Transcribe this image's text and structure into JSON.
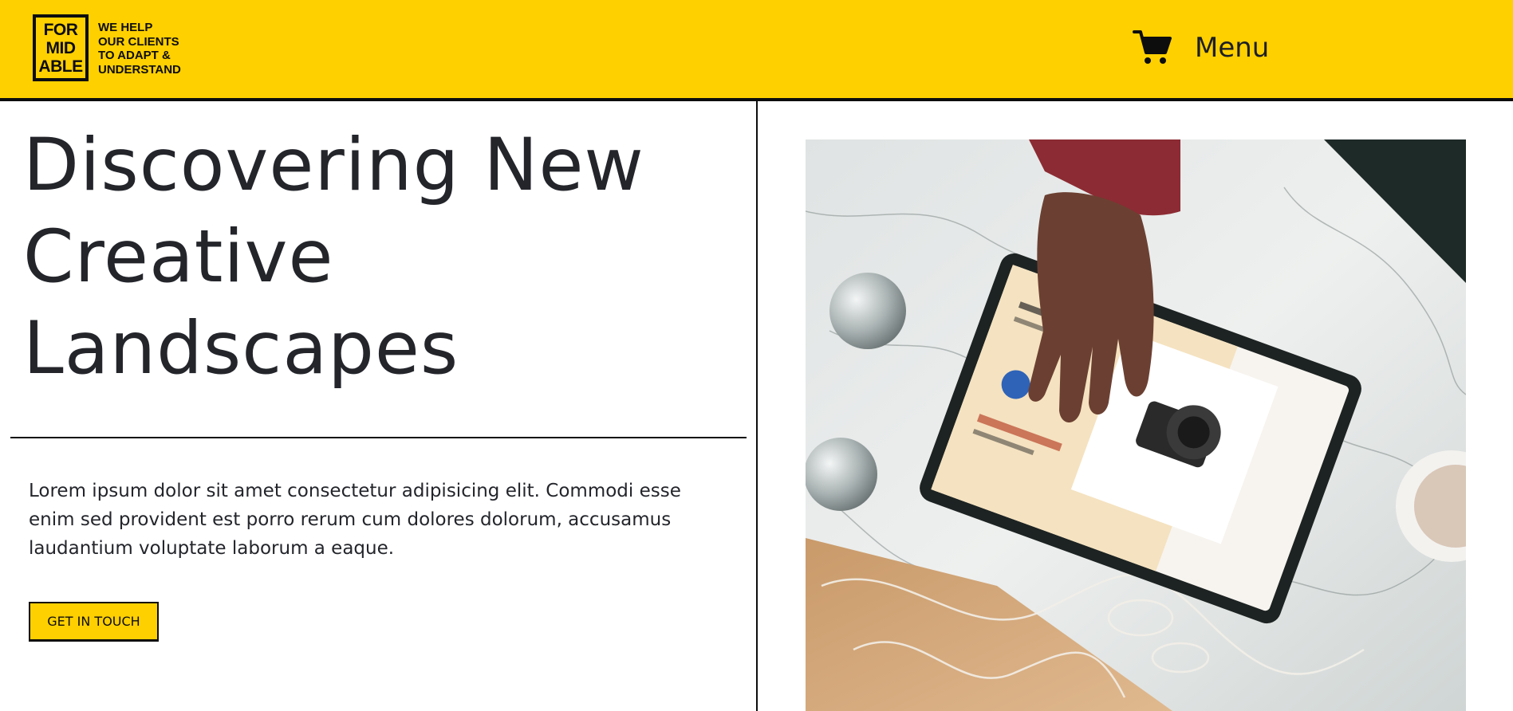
{
  "header": {
    "logo_lines": [
      "FOR",
      "MID",
      "ABLE"
    ],
    "tagline_lines": [
      "WE HELP",
      "OUR CLIENTS",
      "TO ADAPT &",
      "UNDERSTAND"
    ],
    "cart_icon": "shopping-cart-icon",
    "menu_label": "Menu"
  },
  "hero": {
    "title_lines": [
      "Discovering New",
      "Creative",
      "Landscapes"
    ],
    "body": "Lorem ipsum dolor sit amet consectetur adipisicing elit. Commodi esse enim sed provident est porro rerum cum dolores dolorum, accusamus laudantium voluptate laborum a eaque.",
    "cta_label": "GET IN TOUCH"
  },
  "colors": {
    "brand_yellow": "#ffd000",
    "ink": "#0d0d0d",
    "text": "#23252b"
  }
}
